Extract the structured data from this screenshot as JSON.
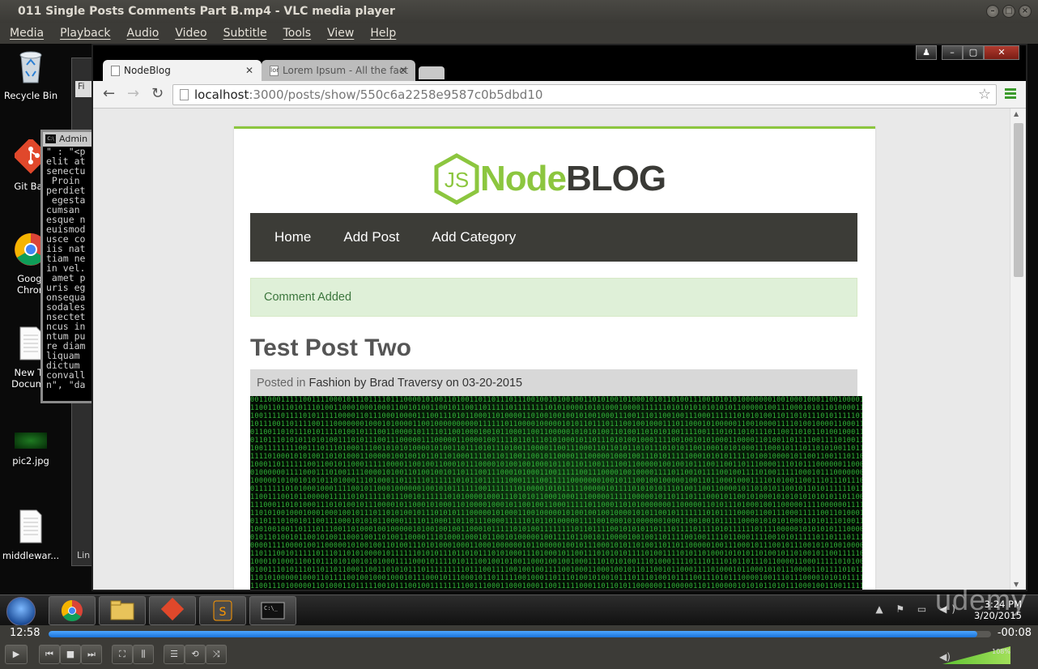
{
  "vlc": {
    "title": "011 Single Posts  Comments Part B.mp4 - VLC media player",
    "menu": [
      "Media",
      "Playback",
      "Audio",
      "Video",
      "Subtitle",
      "Tools",
      "View",
      "Help"
    ],
    "elapsed": "12:58",
    "remaining": "-00:08",
    "progress": 0.985,
    "volume_label": "108%",
    "volume": 1.08,
    "accent": "#1a72d8"
  },
  "desktop": {
    "icons": [
      "Recycle Bin",
      "Git Bas",
      "Googl Chron",
      "New Te Docume",
      "pic2.jpg",
      "middlewar..."
    ],
    "cmd_title": "Admin",
    "cmd_lines": [
      "\" : \"<p",
      "elit at",
      "senectu",
      " Proin ",
      "perdiet",
      " egesta",
      "cumsan ",
      "esque n",
      "euismod",
      "usce co",
      "iis nat",
      "tiam ne",
      "in vel.",
      " amet p",
      "uris eg",
      "onsequa",
      "sodales",
      "nsectet",
      "ncus in",
      "ntum pu",
      "re diam",
      "liquam ",
      "dictum ",
      "convall",
      "n\", \"da"
    ],
    "behind_frag": "Fi",
    "behind_lin": "Lin"
  },
  "browser": {
    "tabs": [
      {
        "label": "NodeBlog",
        "active": true
      },
      {
        "label": "Lorem Ipsum - All the fact",
        "active": false
      }
    ],
    "url_host": "localhost",
    "url_path": ":3000/posts/show/550c6a2258e9587c0b5dbd10"
  },
  "site": {
    "logo_badge": "JS",
    "logo_node": "Node",
    "logo_blog": "BLOG",
    "nav": [
      "Home",
      "Add Post",
      "Add Category"
    ],
    "alert": "Comment Added",
    "post_title": "Test Post Two",
    "meta_prefix": "Posted in ",
    "meta_category": "Fashion",
    "meta_by": " by ",
    "meta_author": "Brad Traversy",
    "meta_on": " on ",
    "meta_date": "03-20-2015",
    "brand_green": "#8cc63f",
    "nav_bg": "#3c3c37"
  },
  "taskbar": {
    "time": "3:24 PM",
    "date": "3/20/2015"
  },
  "watermark": "udemy"
}
